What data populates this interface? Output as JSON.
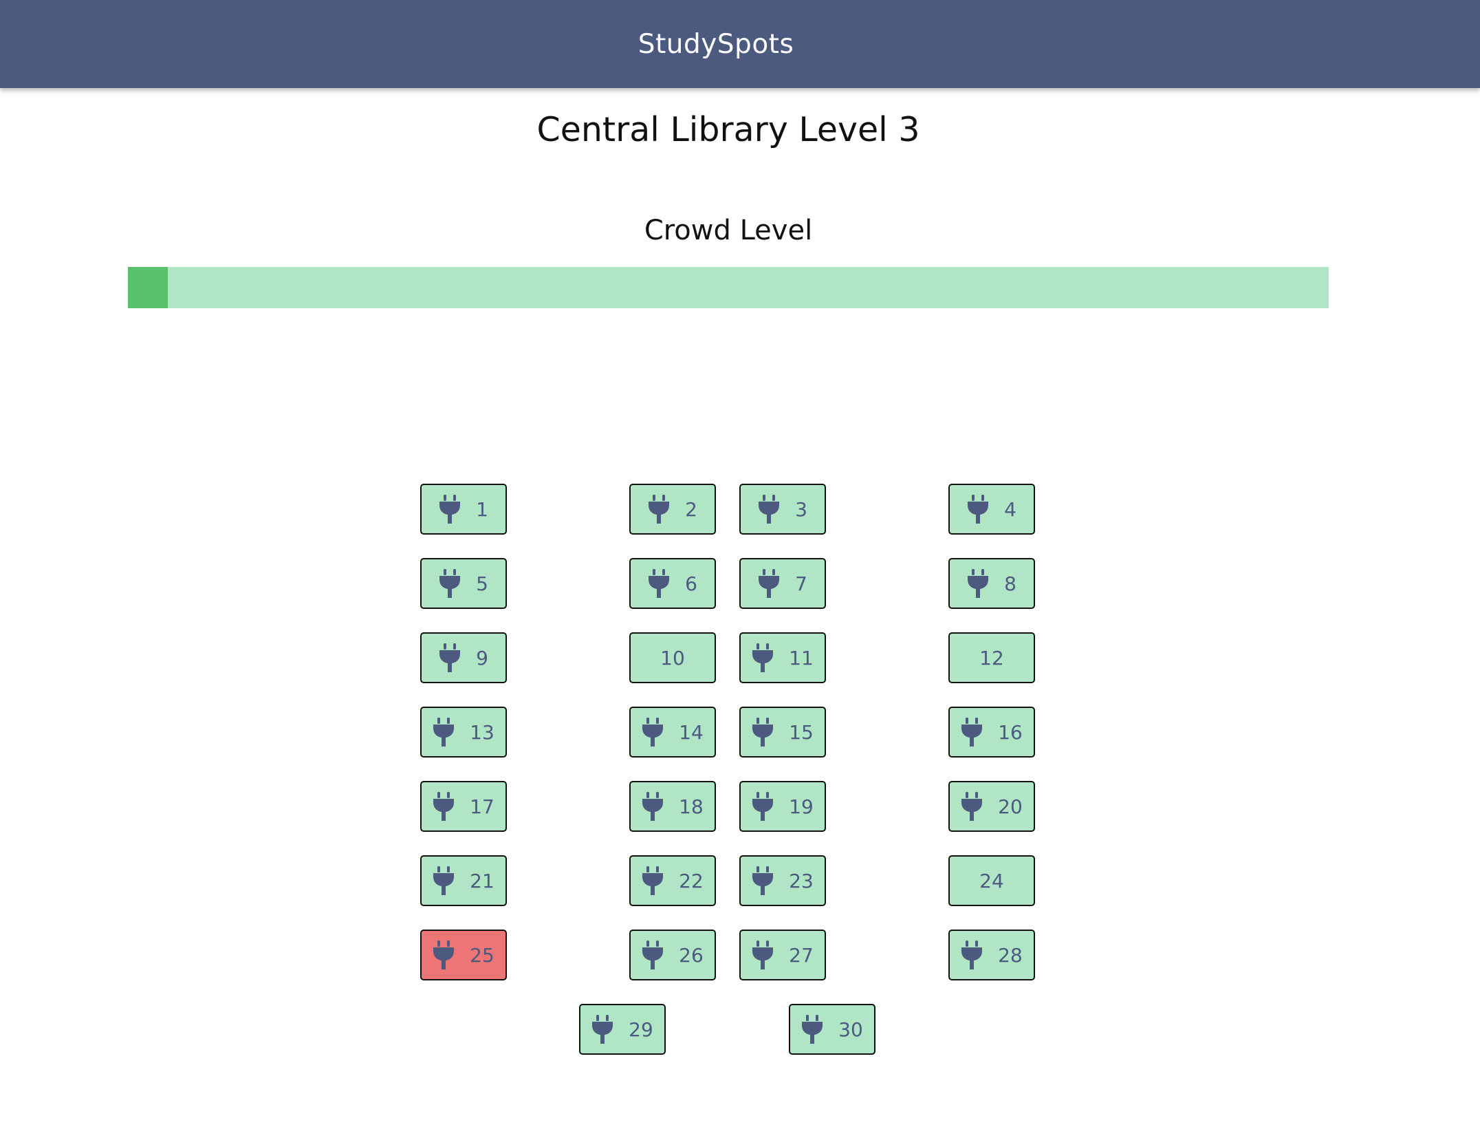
{
  "app": {
    "title": "StudySpots"
  },
  "page": {
    "title": "Central Library Level 3"
  },
  "crowd": {
    "label": "Crowd Level",
    "level": 0.033,
    "track_color": "#b0e5c5",
    "fill_color": "#57c26a"
  },
  "colors": {
    "header": "#4c5a80",
    "available": "#b0e5c5",
    "occupied": "#ee7575",
    "icon": "#4c5a80"
  },
  "seats": [
    {
      "number": "1",
      "has_outlet": true,
      "status": "available"
    },
    {
      "number": "2",
      "has_outlet": true,
      "status": "available"
    },
    {
      "number": "3",
      "has_outlet": true,
      "status": "available"
    },
    {
      "number": "4",
      "has_outlet": true,
      "status": "available"
    },
    {
      "number": "5",
      "has_outlet": true,
      "status": "available"
    },
    {
      "number": "6",
      "has_outlet": true,
      "status": "available"
    },
    {
      "number": "7",
      "has_outlet": true,
      "status": "available"
    },
    {
      "number": "8",
      "has_outlet": true,
      "status": "available"
    },
    {
      "number": "9",
      "has_outlet": true,
      "status": "available"
    },
    {
      "number": "10",
      "has_outlet": false,
      "status": "available"
    },
    {
      "number": "11",
      "has_outlet": true,
      "status": "available"
    },
    {
      "number": "12",
      "has_outlet": false,
      "status": "available"
    },
    {
      "number": "13",
      "has_outlet": true,
      "status": "available"
    },
    {
      "number": "14",
      "has_outlet": true,
      "status": "available"
    },
    {
      "number": "15",
      "has_outlet": true,
      "status": "available"
    },
    {
      "number": "16",
      "has_outlet": true,
      "status": "available"
    },
    {
      "number": "17",
      "has_outlet": true,
      "status": "available"
    },
    {
      "number": "18",
      "has_outlet": true,
      "status": "available"
    },
    {
      "number": "19",
      "has_outlet": true,
      "status": "available"
    },
    {
      "number": "20",
      "has_outlet": true,
      "status": "available"
    },
    {
      "number": "21",
      "has_outlet": true,
      "status": "available"
    },
    {
      "number": "22",
      "has_outlet": true,
      "status": "available"
    },
    {
      "number": "23",
      "has_outlet": true,
      "status": "available"
    },
    {
      "number": "24",
      "has_outlet": false,
      "status": "available"
    },
    {
      "number": "25",
      "has_outlet": true,
      "status": "occupied"
    },
    {
      "number": "26",
      "has_outlet": true,
      "status": "available"
    },
    {
      "number": "27",
      "has_outlet": true,
      "status": "available"
    },
    {
      "number": "28",
      "has_outlet": true,
      "status": "available"
    },
    {
      "number": "29",
      "has_outlet": true,
      "status": "available"
    },
    {
      "number": "30",
      "has_outlet": true,
      "status": "available"
    }
  ]
}
